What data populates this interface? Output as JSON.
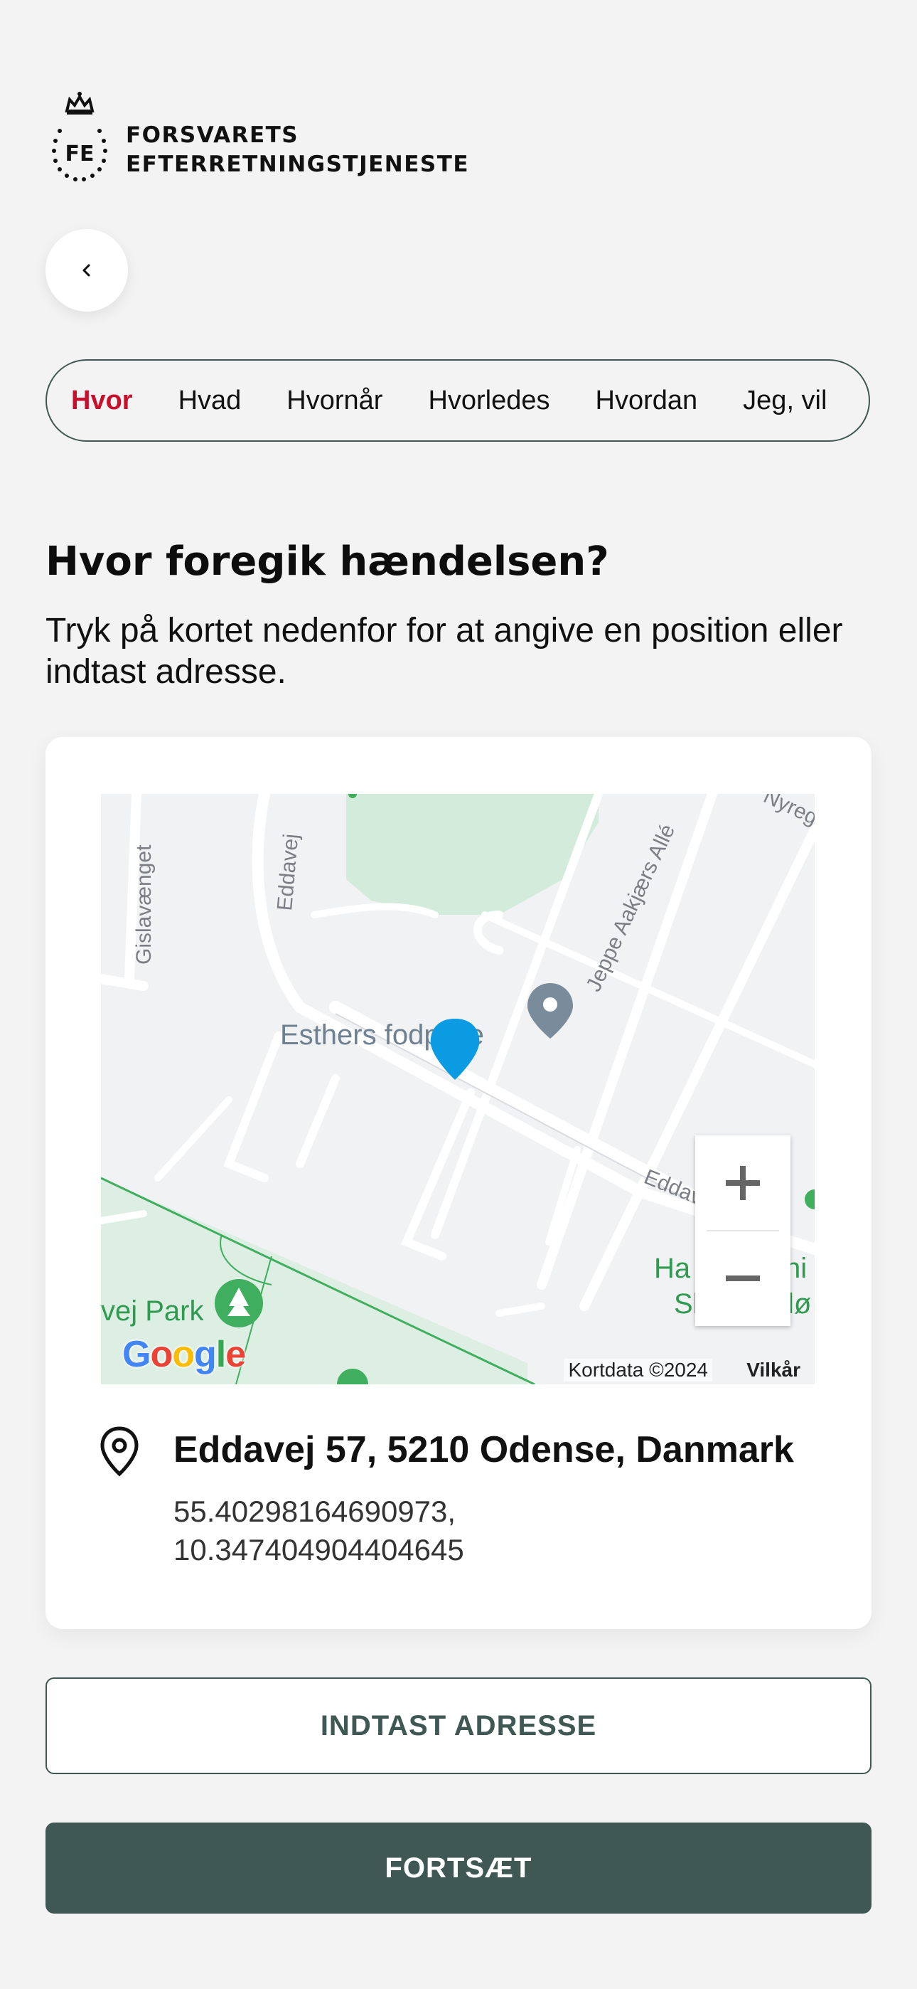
{
  "org": {
    "logo_initials": "FE",
    "name_line1": "FORSVARETS",
    "name_line2": "EFTERRETNINGSTJENESTE"
  },
  "nav": {
    "back_icon": "chevron-left-icon",
    "tabs": [
      {
        "label": "Hvor",
        "active": true
      },
      {
        "label": "Hvad",
        "active": false
      },
      {
        "label": "Hvornår",
        "active": false
      },
      {
        "label": "Hvorledes",
        "active": false
      },
      {
        "label": "Hvordan",
        "active": false
      },
      {
        "label": "Jeg, vil",
        "active": false
      }
    ]
  },
  "page": {
    "title": "Hvor foregik hændelsen?",
    "instructions": "Tryk på kortet nedenfor for at angive en position eller indtast adresse."
  },
  "map": {
    "street_labels": [
      "Gislavænget",
      "Eddavej",
      "Jeppe Aakjærs Allé",
      "Eddavej",
      "Nyrege"
    ],
    "poi_labels": [
      "Esthers fodpleje",
      "vej Park",
      "Ha",
      "ni",
      "Sk",
      "lø"
    ],
    "copyright": "Kortdata ©2024",
    "terms": "Vilkår",
    "google_logo": "Google",
    "zoom_in_icon": "plus-icon",
    "zoom_out_icon": "minus-icon"
  },
  "location": {
    "address": "Eddavej 57, 5210 Odense, Danmark",
    "lat": "55.40298164690973,",
    "lng": "10.347404904404645"
  },
  "actions": {
    "enter_address": "INDTAST ADRESSE",
    "continue": "FORTSÆT"
  },
  "colors": {
    "accent_red": "#c8102e",
    "primary_green": "#3f5853",
    "marker_blue": "#0a9be3",
    "park_green": "#d2ebdb"
  }
}
